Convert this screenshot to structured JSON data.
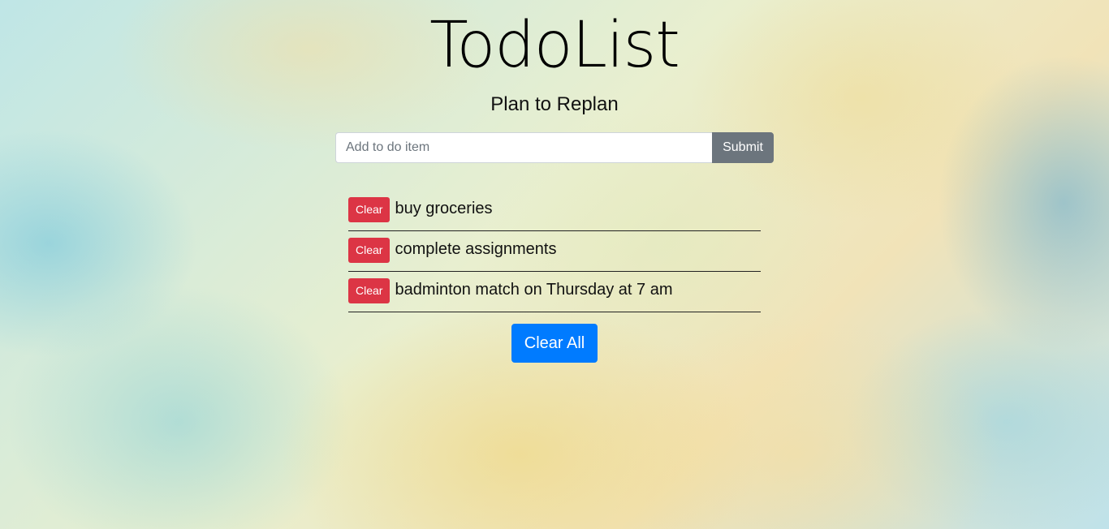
{
  "header": {
    "title": "TodoList",
    "subtitle": "Plan to Replan"
  },
  "form": {
    "input_value": "",
    "input_placeholder": "Add to do item",
    "submit_label": "Submit"
  },
  "todos": [
    {
      "text": "buy groceries",
      "clear_label": "Clear"
    },
    {
      "text": "complete assignments",
      "clear_label": "Clear"
    },
    {
      "text": "badminton match on Thursday at 7 am",
      "clear_label": "Clear"
    }
  ],
  "actions": {
    "clear_all_label": "Clear All"
  },
  "colors": {
    "clear_button": "#dc3545",
    "submit_button": "#6c757d",
    "clear_all_button": "#007bff"
  }
}
